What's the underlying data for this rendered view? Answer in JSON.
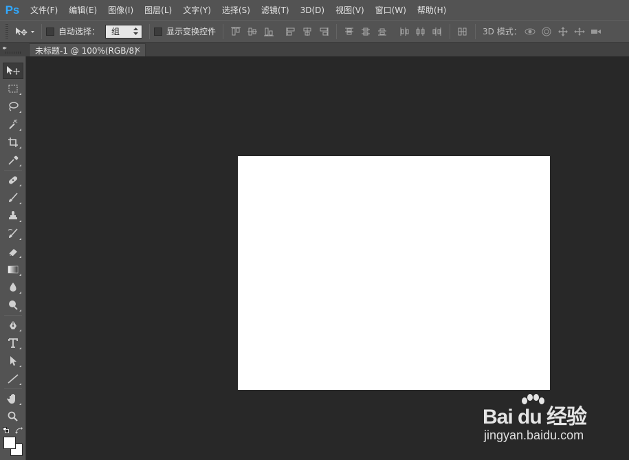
{
  "app": {
    "logo": "Ps"
  },
  "menu": [
    "文件(F)",
    "编辑(E)",
    "图像(I)",
    "图层(L)",
    "文字(Y)",
    "选择(S)",
    "滤镜(T)",
    "3D(D)",
    "视图(V)",
    "窗口(W)",
    "帮助(H)"
  ],
  "options": {
    "auto_select_label": "自动选择：",
    "auto_select_value": "组",
    "show_transform_label": "显示变换控件",
    "mode_3d_label": "3D 模式："
  },
  "document": {
    "tab_title": "未标题-1 @ 100%(RGB/8)",
    "close_glyph": "×",
    "canvas_color": "#ffffff"
  },
  "colors": {
    "foreground": "#ffffff",
    "background": "#ffffff",
    "ps_blue": "#31a8ff"
  },
  "watermark": {
    "brand": "Bai du 经验",
    "url": "jingyan.baidu.com"
  },
  "tools": [
    "move-tool",
    "marquee-tool",
    "lasso-tool",
    "magic-wand-tool",
    "crop-tool",
    "eyedropper-tool",
    "healing-brush-tool",
    "brush-tool",
    "clone-stamp-tool",
    "history-brush-tool",
    "eraser-tool",
    "gradient-tool",
    "blur-tool",
    "dodge-tool",
    "pen-tool",
    "type-tool",
    "path-selection-tool",
    "line-tool",
    "hand-tool",
    "zoom-tool"
  ]
}
